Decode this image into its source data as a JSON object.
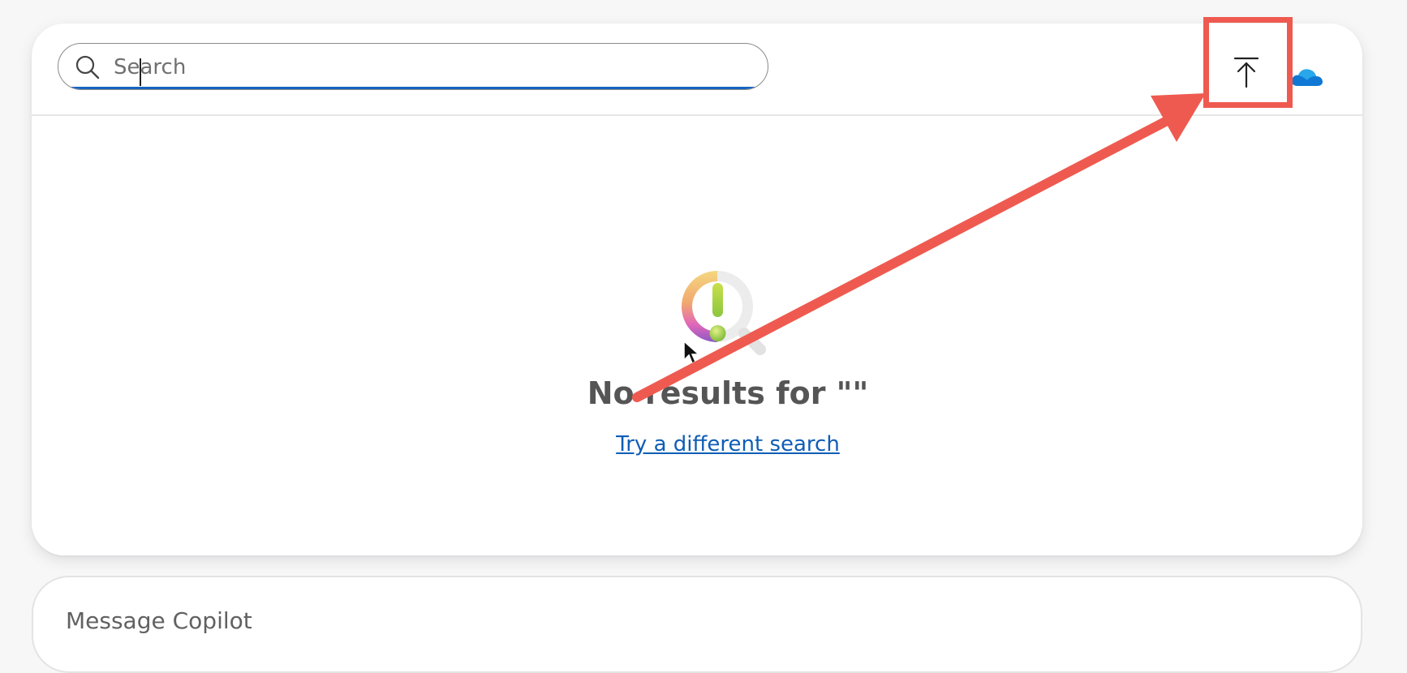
{
  "search": {
    "placeholder": "Search",
    "value": ""
  },
  "header": {
    "upload_icon": "upload-to-top-icon",
    "cloud_icon": "onedrive-cloud-icon"
  },
  "empty_state": {
    "title": "No results for \"\"",
    "link": "Try a different search",
    "illustration": "no-results-magnifier-illustration"
  },
  "composer": {
    "placeholder": "Message Copilot"
  },
  "colors": {
    "accent": "#1565c0",
    "link": "#0f5db6",
    "annotation": "#ef5a50",
    "cloud": "#0f78d4"
  }
}
